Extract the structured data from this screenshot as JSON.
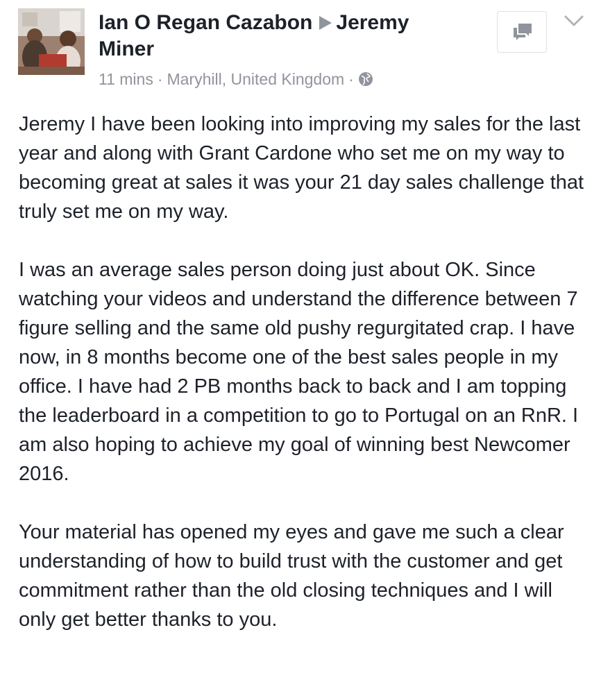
{
  "post": {
    "author": "Ian O Regan Cazabon",
    "recipient": "Jeremy Miner",
    "time": "11 mins",
    "location": "Maryhill, United Kingdom",
    "separator": "·",
    "privacy_icon": "globe-icon",
    "message_icon": "message-icon",
    "menu_icon": "chevron-down-icon",
    "paragraphs": [
      "Jeremy I have been looking into improving my sales for the last year and along with Grant Cardone who set me on my way to becoming great at sales it was your 21 day sales challenge that truly set me on my way.",
      "I was an average sales person doing just about OK. Since watching your videos and understand the difference between 7 figure selling and the same old pushy regurgitated crap. I have now, in 8 months become one of the best sales people in my office. I have had 2 PB months back to back and I am topping the leaderboard in a competition to go to Portugal on an RnR. I am also hoping to achieve my goal of winning best Newcomer 2016.",
      "Your material has opened my eyes and gave me such a clear understanding of how to build trust with the customer and get commitment rather than the old closing techniques and I will only get better thanks to you."
    ]
  },
  "colors": {
    "text": "#1d2129",
    "muted": "#90949c",
    "border": "#dddfe2"
  }
}
